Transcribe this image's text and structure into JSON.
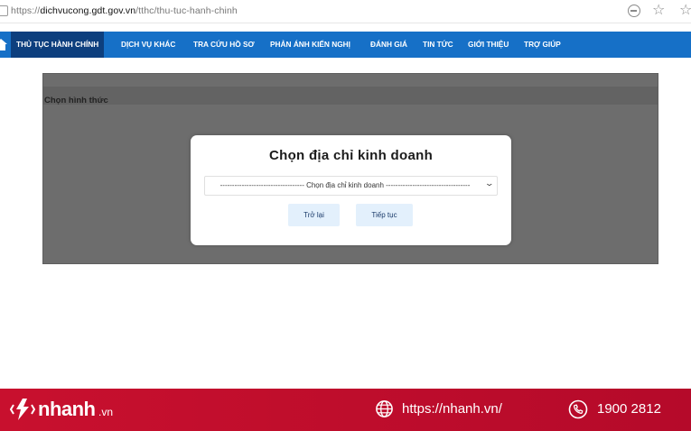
{
  "browser": {
    "url_prefix": "https://",
    "url_domain": "dichvucong.gdt.gov.vn",
    "url_path": "/tthc/thu-tuc-hanh-chinh"
  },
  "nav": {
    "items": [
      {
        "label": "THỦ TỤC HÀNH CHÍNH",
        "active": true
      },
      {
        "label": "DỊCH VỤ KHÁC"
      },
      {
        "label": "TRA CỨU HỒ SƠ"
      },
      {
        "label": "PHẢN ÁNH KIẾN NGHỊ"
      },
      {
        "label": "ĐÁNH GIÁ"
      },
      {
        "label": "TIN TỨC"
      },
      {
        "label": "GIỚI THIỆU"
      },
      {
        "label": "TRỢ GIÚP"
      }
    ]
  },
  "panel": {
    "label": "Chọn hình thức"
  },
  "modal": {
    "title": "Chọn địa chỉ kinh doanh",
    "select_value": "----------------------------------- Chọn địa chỉ kinh doanh -----------------------------------",
    "back_button": "Trở lại",
    "next_button": "Tiếp tục"
  },
  "footer": {
    "brand": "nhanh",
    "brand_suffix": ".vn",
    "website": "https://nhanh.vn/",
    "phone": "1900 2812",
    "colors": {
      "background": "#c8102e",
      "text": "#ffffff"
    }
  },
  "colors": {
    "nav_background": "#1670c7",
    "nav_active": "#0d3f7e",
    "overlay": "#6d6d6d",
    "button_background": "#e3f0fc"
  },
  "icons": [
    "page-icon",
    "zoom-out-icon",
    "star-icon",
    "favorites-icon",
    "home-icon",
    "chevron-down-icon",
    "nhanh-logo-icon",
    "globe-icon",
    "phone-icon"
  ]
}
